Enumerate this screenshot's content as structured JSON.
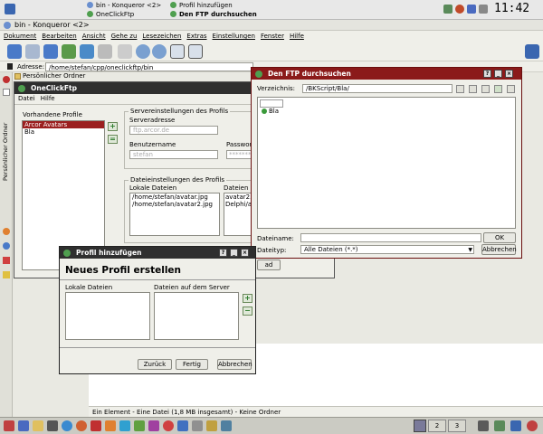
{
  "top_panel": {
    "tasks": [
      {
        "label": "bin - Konqueror <2>",
        "color": "#6a8fcf"
      },
      {
        "label": "OneClickFtp",
        "color": "#4f9f4f"
      },
      {
        "label": "Profil hinzufügen",
        "color": "#4f9f4f"
      },
      {
        "label": "Den FTP durchsuchen",
        "color": "#4f9f4f"
      }
    ],
    "clock": "11:42"
  },
  "konqueror": {
    "title": "bin - Konqueror <2>",
    "menu": [
      "Dokument",
      "Bearbeiten",
      "Ansicht",
      "Gehe zu",
      "Lesezeichen",
      "Extras",
      "Einstellungen",
      "Fenster",
      "Hilfe"
    ],
    "location_label": "Adresse:",
    "location_value": "/home/stefan/cpp/oneclickftp/bin",
    "sidebar_label": "Persönlicher Ordner",
    "status": "Ein Element - Eine Datei (1,8 MB insgesamt) - Keine Ordner"
  },
  "oneclickftp": {
    "title": "OneClickFtp",
    "menu": [
      "Datei",
      "Hilfe"
    ],
    "profiles_label": "Vorhandene Profile",
    "profiles": [
      "Arcor Avatars",
      "Bla"
    ],
    "server_group": "Servereinstellungen des Profils",
    "server_address_label": "Serveradresse",
    "server_address_value": "ftp.arcor.de",
    "username_label": "Benutzername",
    "username_value": "stefan",
    "password_label": "Passwort",
    "password_value": "********",
    "files_group": "Dateieinstellungen des Profils",
    "local_files_label": "Lokale Dateien",
    "local_files": [
      "/home/stefan/avatar.jpg",
      "/home/stefan/avatar2.jpg"
    ],
    "server_files_label": "Dateien auf",
    "server_files": [
      "avatar2.jp",
      "Delphi/ava"
    ],
    "button_fragment": "ad"
  },
  "ftp_browser": {
    "title": "Den FTP durchsuchen",
    "dir_label": "Verzeichnis:",
    "dir_value": "/BKScript/Bla/",
    "items": [
      "Bla"
    ],
    "filename_label": "Dateiname:",
    "filename_value": "",
    "filetype_label": "Dateityp:",
    "filetype_value": "Alle Dateien (*.*)",
    "ok": "OK",
    "cancel": "Abbrechen"
  },
  "add_profile": {
    "title": "Profil hinzufügen",
    "heading": "Neues Profil erstellen",
    "local_label": "Lokale Dateien",
    "server_label": "Dateien auf dem Server",
    "back": "Zurück",
    "finish": "Fertig",
    "cancel": "Abbrechen"
  },
  "bottom_panel": {
    "desktops": [
      "2",
      "3"
    ]
  },
  "colors": {
    "active_title": "#8b1a1a",
    "inactive_title": "#2f2f2f",
    "selection": "#9b1f1f"
  }
}
